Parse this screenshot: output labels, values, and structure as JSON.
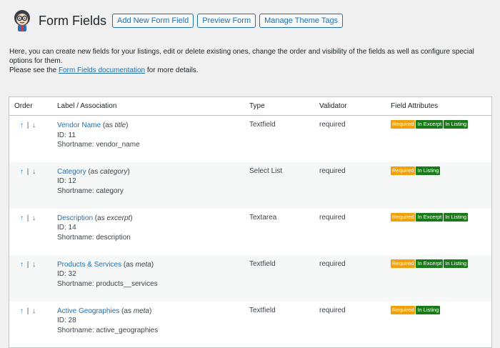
{
  "header": {
    "title": "Form Fields",
    "buttons": [
      "Add New Form Field",
      "Preview Form",
      "Manage Theme Tags"
    ]
  },
  "intro": {
    "line1": "Here, you can create new fields for your listings, edit or delete existing ones, change the order and visibility of the fields as well as configure special options for them.",
    "line2_pre": "Please see the ",
    "line2_link": "Form Fields documentation",
    "line2_post": " for more details."
  },
  "table": {
    "columns": [
      "Order",
      "Label / Association",
      "Type",
      "Validator",
      "Field Attributes"
    ],
    "rows": [
      {
        "order_up": "↑",
        "order_sep": "|",
        "order_down": "↓",
        "name": "Vendor Name",
        "assoc_pre": " (as ",
        "assoc": "title",
        "assoc_post": ")",
        "id": "ID: 11",
        "shortname": "Shortname: vendor_name",
        "type": "Textfield",
        "validator": "required",
        "badges": [
          "Required",
          "In Excerpt",
          "In Listing"
        ]
      },
      {
        "order_up": "↑",
        "order_sep": "|",
        "order_down": "↓",
        "name": "Category",
        "assoc_pre": " (as ",
        "assoc": "category",
        "assoc_post": ")",
        "id": "ID: 12",
        "shortname": "Shortname: category",
        "type": "Select List",
        "validator": "required",
        "badges": [
          "Required",
          "In Listing"
        ]
      },
      {
        "order_up": "↑",
        "order_sep": "|",
        "order_down": "↓",
        "name": "Description",
        "assoc_pre": " (as ",
        "assoc": "excerpt",
        "assoc_post": ")",
        "id": "ID: 14",
        "shortname": "Shortname: description",
        "type": "Textarea",
        "validator": "required",
        "badges": [
          "Required",
          "In Excerpt",
          "In Listing"
        ]
      },
      {
        "order_up": "↑",
        "order_sep": "|",
        "order_down": "↓",
        "name": "Products & Services",
        "assoc_pre": " (as ",
        "assoc": "meta",
        "assoc_post": ")",
        "id": "ID: 32",
        "shortname": "Shortname: products__services",
        "type": "Textfield",
        "validator": "required",
        "badges": [
          "Required",
          "In Excerpt",
          "In Listing"
        ]
      },
      {
        "order_up": "↑",
        "order_sep": "|",
        "order_down": "↓",
        "name": "Active Geographies",
        "assoc_pre": " (as ",
        "assoc": "meta",
        "assoc_post": ")",
        "id": "ID: 28",
        "shortname": "Shortname: active_geographies",
        "type": "Textfield",
        "validator": "required",
        "badges": [
          "Required",
          "In Listing"
        ]
      }
    ]
  },
  "colors": {
    "accent": "#2271b1",
    "required_badge": "#f0a00a",
    "listing_badge": "#1a7a1a"
  }
}
